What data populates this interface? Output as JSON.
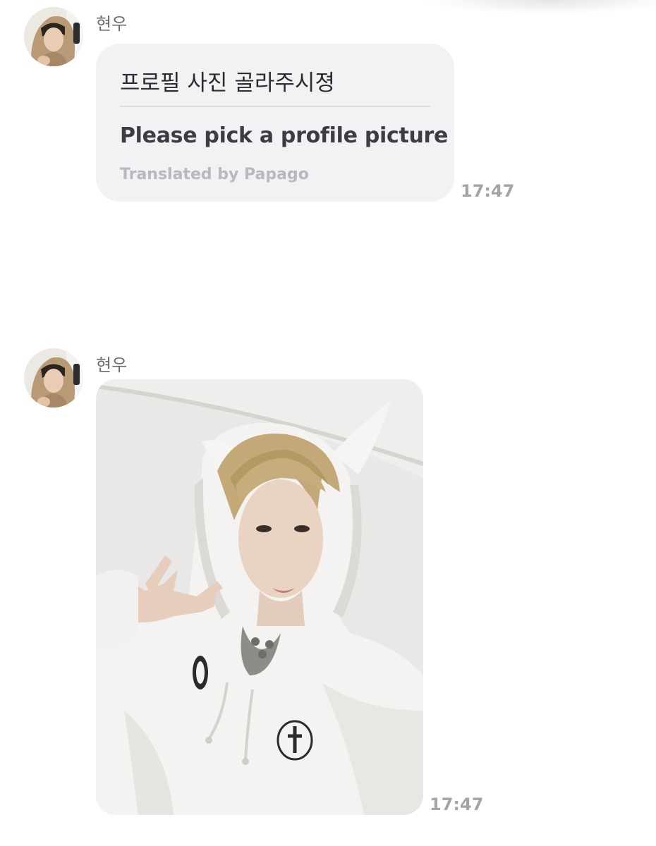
{
  "messages": [
    {
      "sender": "현우",
      "avatar_icon": "profile-photo",
      "original_text": "프로필 사진 골라주시졍",
      "translated_text": "Please pick a profile picture",
      "translation_credit": "Translated by Papago",
      "time": "17:47"
    },
    {
      "sender": "현우",
      "avatar_icon": "profile-photo",
      "attachment": "photo",
      "time": "17:47"
    }
  ],
  "colors": {
    "bubble_bg": "#f2f2f4",
    "sender_text": "#6b6b72",
    "time_text": "#a3a3aa",
    "credit_text": "#b8b8be"
  }
}
